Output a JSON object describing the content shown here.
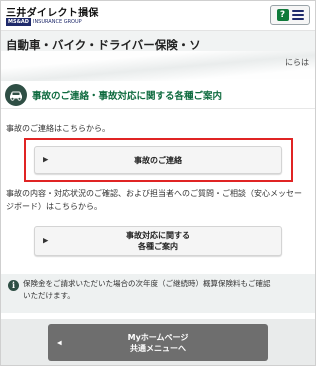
{
  "header": {
    "logo_main": "三井ダイレクト損保",
    "logo_ms": "MS&AD",
    "logo_sub": "INSURANCE GROUP",
    "help_label": "?"
  },
  "page": {
    "title": "自動車・バイク・ドライバー保険・ソ",
    "title_ghost": "にらは"
  },
  "section": {
    "title": "事故のご連絡・事故対応に関する各種ご案内"
  },
  "contact": {
    "intro": "事故のご連絡はこちらから。",
    "button_label": "事故のご連絡"
  },
  "inquiry": {
    "intro_line1": "事故の内容・対応状況のご確認、および担当者へのご質問・ご相談（安心メッセー",
    "intro_line2": "ジボード）はこちらから。",
    "button_line1": "事故対応に関する",
    "button_line2": "各種ご案内"
  },
  "note": {
    "line1": "保険金をご請求いただいた場合の次年度（ご継続時）概算保険料もご確認",
    "line2": "いただけます。"
  },
  "footer": {
    "button_line1": "Myホームページ",
    "button_line2": "共通メニューへ"
  },
  "colors": {
    "accent_green": "#0f6b3f",
    "highlight_red": "#e02424"
  }
}
